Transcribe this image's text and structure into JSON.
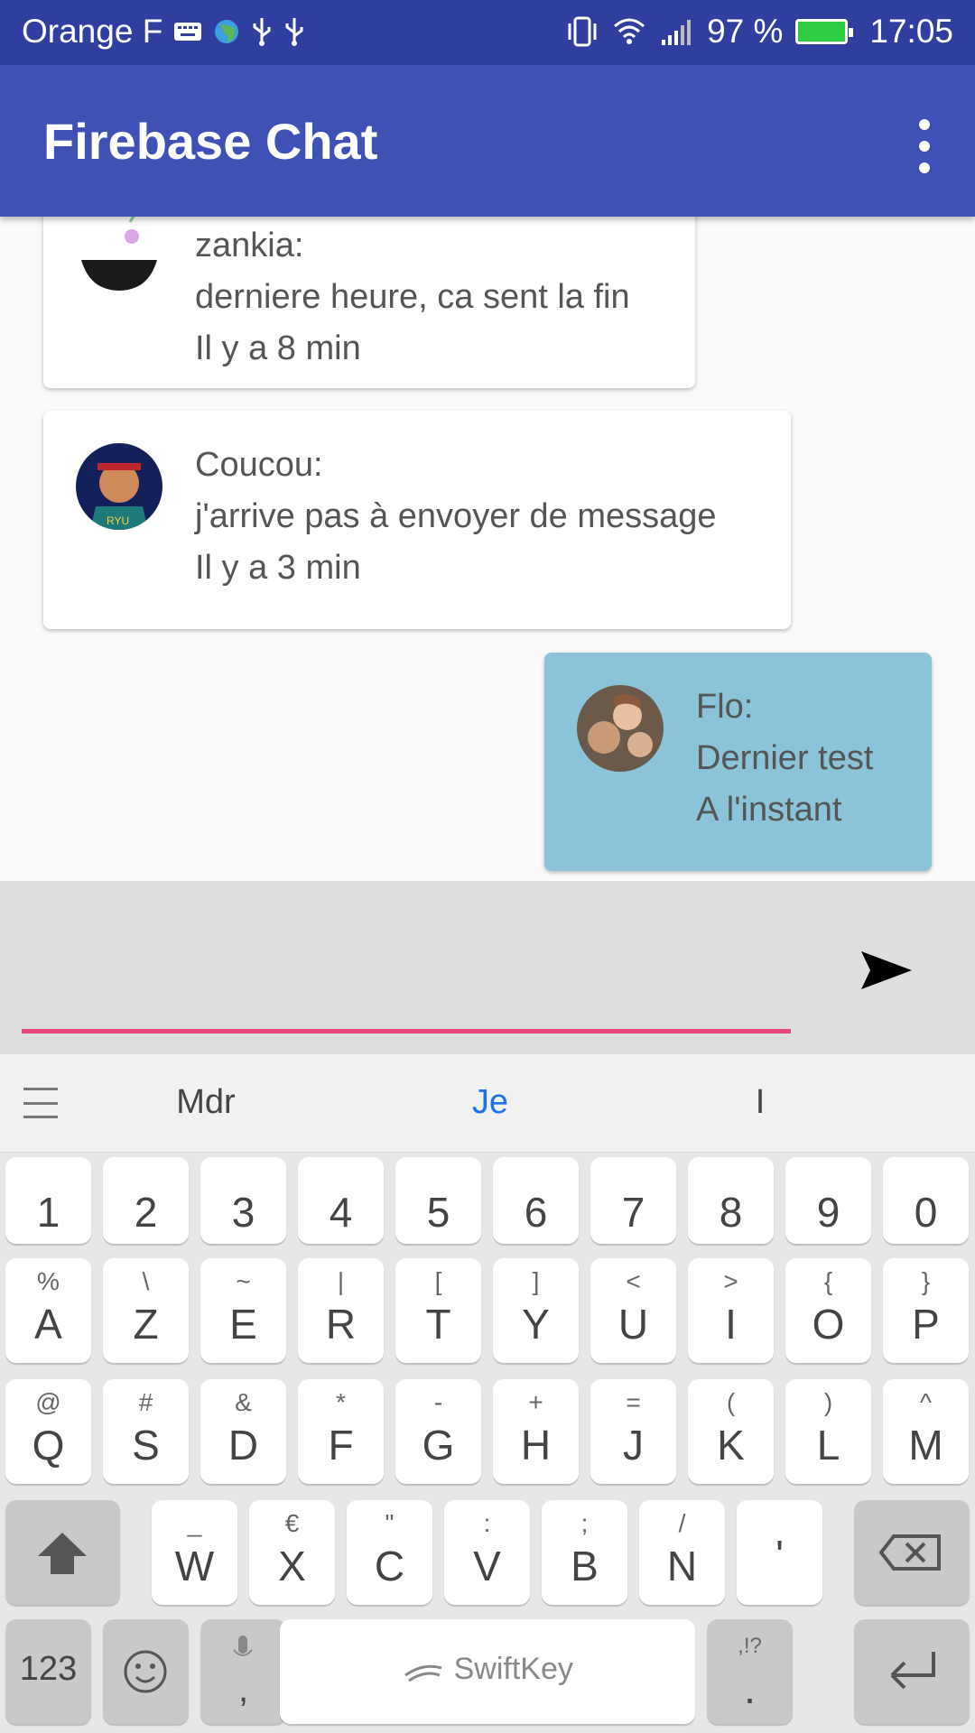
{
  "status_bar": {
    "carrier": "Orange F",
    "battery_percent": "97 %",
    "time": "17:05"
  },
  "app_bar": {
    "title": "Firebase Chat"
  },
  "messages": [
    {
      "author": "zankia:",
      "text": "derniere heure, ca sent la fin",
      "time": "Il y a 8 min",
      "mine": false
    },
    {
      "author": "Coucou:",
      "text": "j'arrive pas à envoyer de message",
      "time": "Il y a 3 min",
      "mine": false
    },
    {
      "author": "Flo:",
      "text": "Dernier test",
      "time": "A l'instant",
      "mine": true
    }
  ],
  "input": {
    "value": "",
    "placeholder": ""
  },
  "keyboard": {
    "suggestions": [
      "Mdr",
      "Je",
      "I"
    ],
    "row_numbers": [
      "1",
      "2",
      "3",
      "4",
      "5",
      "6",
      "7",
      "8",
      "9",
      "0"
    ],
    "row1": [
      {
        "main": "A",
        "sub": "%"
      },
      {
        "main": "Z",
        "sub": "\\"
      },
      {
        "main": "E",
        "sub": "~"
      },
      {
        "main": "R",
        "sub": "|"
      },
      {
        "main": "T",
        "sub": "["
      },
      {
        "main": "Y",
        "sub": "]"
      },
      {
        "main": "U",
        "sub": "<"
      },
      {
        "main": "I",
        "sub": ">"
      },
      {
        "main": "O",
        "sub": "{"
      },
      {
        "main": "P",
        "sub": "}"
      }
    ],
    "row2": [
      {
        "main": "Q",
        "sub": "@"
      },
      {
        "main": "S",
        "sub": "#"
      },
      {
        "main": "D",
        "sub": "&"
      },
      {
        "main": "F",
        "sub": "*"
      },
      {
        "main": "G",
        "sub": "-"
      },
      {
        "main": "H",
        "sub": "+"
      },
      {
        "main": "J",
        "sub": "="
      },
      {
        "main": "K",
        "sub": "("
      },
      {
        "main": "L",
        "sub": ")"
      },
      {
        "main": "M",
        "sub": "^"
      }
    ],
    "row3": [
      {
        "main": "W",
        "sub": "_"
      },
      {
        "main": "X",
        "sub": "€"
      },
      {
        "main": "C",
        "sub": "\""
      },
      {
        "main": "V",
        "sub": ":"
      },
      {
        "main": "B",
        "sub": ";"
      },
      {
        "main": "N",
        "sub": "/"
      },
      {
        "main": "'",
        "sub": ""
      }
    ],
    "numbers_key": "123",
    "comma_key": ",",
    "space_label": "SwiftKey",
    "period_key": ".",
    "period_sub": ",!?"
  }
}
